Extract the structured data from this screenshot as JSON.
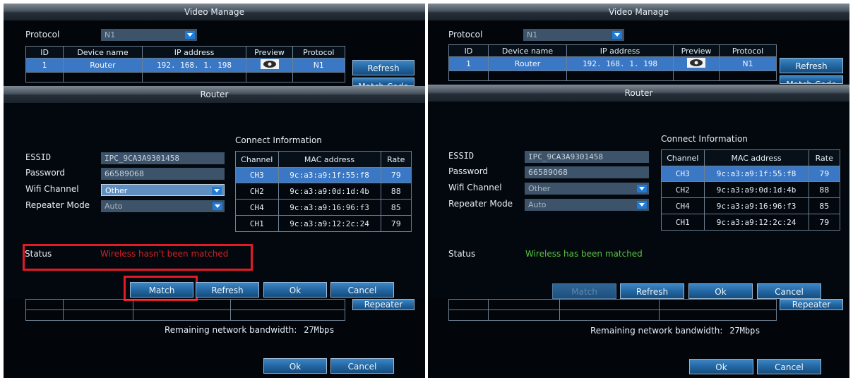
{
  "video_manage": {
    "title": "Video Manage",
    "protocol_label": "Protocol",
    "protocol_value": "N1",
    "table_headers": [
      "ID",
      "Device name",
      "IP address",
      "Preview",
      "Protocol"
    ],
    "row": {
      "id": "1",
      "device_name": "Router",
      "ip": "192. 168. 1. 198",
      "protocol": "N1"
    },
    "refresh_label": "Refresh",
    "match_code_label": "Match Code",
    "repeater_label": "Repeater",
    "bandwidth_label": "Remaining network bandwidth:",
    "bandwidth_value": "27Mbps",
    "ok_label": "Ok",
    "cancel_label": "Cancel"
  },
  "router_dialog": {
    "title": "Router",
    "connect_info_title": "Connect Information",
    "essid_label": "ESSID",
    "essid_value": "IPC_9CA3A9301458",
    "password_label": "Password",
    "password_value": "66589068",
    "wifi_channel_label": "Wifi Channel",
    "wifi_channel_value": "Other",
    "repeater_mode_label": "Repeater Mode",
    "repeater_mode_value": "Auto",
    "channel_headers": [
      "Channel",
      "MAC address",
      "Rate"
    ],
    "channels": [
      {
        "ch": "CH3",
        "mac": "9c:a3:a9:1f:55:f8",
        "rate": "79"
      },
      {
        "ch": "CH2",
        "mac": "9c:a3:a9:0d:1d:4b",
        "rate": "88"
      },
      {
        "ch": "CH4",
        "mac": "9c:a3:a9:16:96:f3",
        "rate": "85"
      },
      {
        "ch": "CH1",
        "mac": "9c:a3:a9:12:2c:24",
        "rate": "79"
      }
    ],
    "status_label": "Status",
    "status_left": "Wireless hasn't been matched",
    "status_right": "Wireless has been matched",
    "match_label": "Match",
    "refresh_label": "Refresh",
    "ok_label": "Ok",
    "cancel_label": "Cancel"
  },
  "colors": {
    "status_error": "#d41f26",
    "status_ok": "#58c442",
    "highlight": "#e21a24",
    "row_selected": "#3a77c4"
  }
}
